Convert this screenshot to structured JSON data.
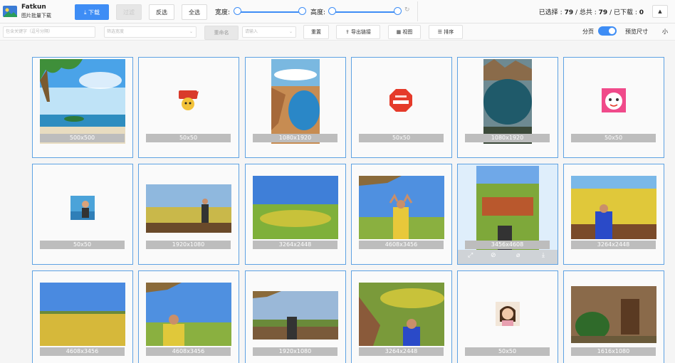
{
  "app": {
    "name": "Fatkun",
    "subtitle": "图片批量下载"
  },
  "toolbar": {
    "download_label": "下载",
    "disabled_label": "过滤",
    "invert_label": "反选",
    "select_all_label": "全选",
    "width_label": "宽度:",
    "height_label": "高度:",
    "width_range": [
      0,
      1
    ],
    "height_range": [
      0,
      1
    ]
  },
  "status": {
    "selected_label": "已选择 :",
    "selected": "79",
    "total_label": "/ 总共 :",
    "total": "79",
    "downloaded_label": "/ 已下载 :",
    "downloaded": "0"
  },
  "filterbar": {
    "keyword_placeholder": "包含关键字（逗号分隔）",
    "filter_placeholder": "筛选宽度",
    "rename_label": "重命名",
    "rename_placeholder": "请输入",
    "reset_label": "重置",
    "export_label": "导出链接",
    "view_label": "视图",
    "sort_label": "排序",
    "paging_label": "分页",
    "paging_on": true,
    "preview_size_label": "预览尺寸",
    "preview_size_value": "小"
  },
  "images": [
    {
      "dims": "500x500"
    },
    {
      "dims": "50x50"
    },
    {
      "dims": "1080x1920"
    },
    {
      "dims": "50x50"
    },
    {
      "dims": "1080x1920"
    },
    {
      "dims": "50x50"
    },
    {
      "dims": "50x50"
    },
    {
      "dims": "1920x1080"
    },
    {
      "dims": "3264x2448"
    },
    {
      "dims": "4608x3456"
    },
    {
      "dims": "3456x4608"
    },
    {
      "dims": "3264x2448"
    },
    {
      "dims": "4608x3456"
    },
    {
      "dims": "4608x3456"
    },
    {
      "dims": "1920x1080"
    },
    {
      "dims": "3264x2448"
    },
    {
      "dims": "50x50"
    },
    {
      "dims": "1616x1080"
    }
  ],
  "colors": {
    "accent": "#3e8df5",
    "card_border": "#5ea2e3",
    "label_bg": "#bdbdbd"
  }
}
